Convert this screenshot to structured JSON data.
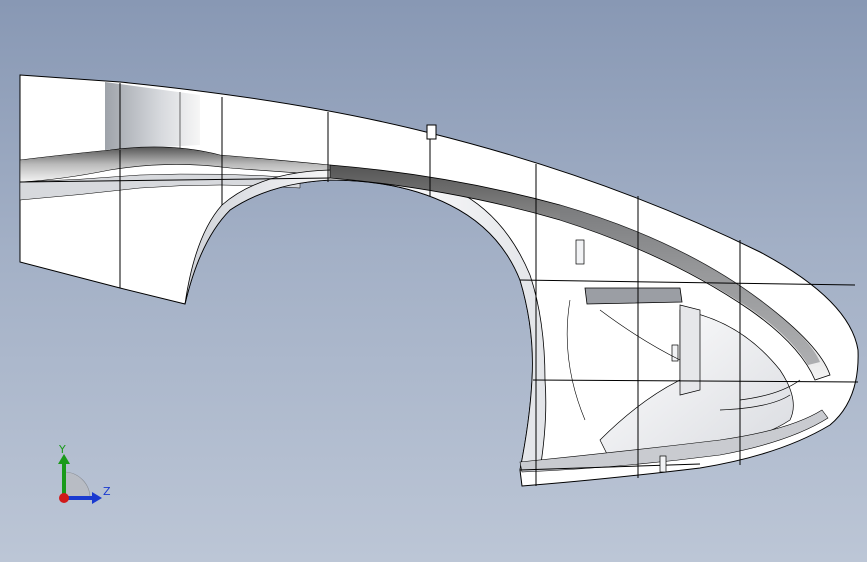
{
  "viewport": {
    "background_top": "#8898b4",
    "background_bottom": "#bcc6d6"
  },
  "model": {
    "part_description": "fender-shell",
    "fill_color": "#ffffff",
    "edge_color": "#000000",
    "shade_color": "#8c8c8c"
  },
  "triad": {
    "y_label": "Y",
    "z_label": "Z",
    "y_color": "#1a9a1a",
    "z_color": "#1a3ad0",
    "x_color": "#d01a1a"
  }
}
